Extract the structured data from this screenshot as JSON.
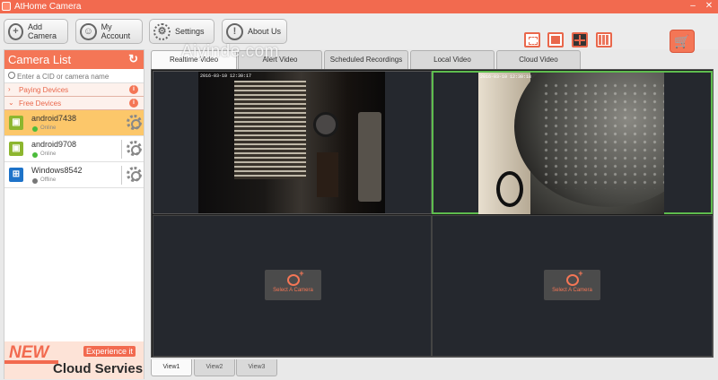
{
  "window": {
    "title": "AtHome Camera",
    "minimize": "–",
    "close": "✕"
  },
  "watermark": "Aiyinde.com",
  "toolbar": {
    "buttons": [
      {
        "label": "Add Camera",
        "icon": "plus-icon"
      },
      {
        "label": "My Account",
        "icon": "user-icon"
      },
      {
        "label": "Settings",
        "icon": "gear-icon"
      },
      {
        "label": "About Us",
        "icon": "info-icon"
      }
    ],
    "layouts": [
      "layout-single-icon",
      "layout-fit-icon",
      "layout-quad-icon",
      "layout-nine-icon"
    ],
    "cart_icon": "cart-icon"
  },
  "sidebar": {
    "title": "Camera List",
    "search_placeholder": "Enter a CID or camera name",
    "groups": [
      {
        "label": "Paying Devices"
      },
      {
        "label": "Free Devices"
      }
    ],
    "cameras": [
      {
        "name": "android7438",
        "status": "Online",
        "os": "android"
      },
      {
        "name": "android9708",
        "status": "Online",
        "os": "android"
      },
      {
        "name": "Windows8542",
        "status": "Offline",
        "os": "windows"
      }
    ],
    "promo": {
      "new": "NEW",
      "experience": "Experience it",
      "cloud": "Cloud Servies"
    }
  },
  "tabs": [
    {
      "label": "Realtime Video"
    },
    {
      "label": "Alert Video"
    },
    {
      "label": "Scheduled Recordings"
    },
    {
      "label": "Local Video"
    },
    {
      "label": "Cloud Video"
    }
  ],
  "panes": {
    "feed1_timestamp": "2016-03-10 12:30:17",
    "feed2_timestamp": "2016-03-10 12:30:18",
    "select_label": "Select A Camera"
  },
  "view_tabs": [
    {
      "label": "View1"
    },
    {
      "label": "View2"
    },
    {
      "label": "View3"
    }
  ],
  "colors": {
    "accent": "#f26a4f",
    "selected_row": "#fcc76a",
    "online": "#4cbc3c",
    "active_pane": "#5ebc4e"
  }
}
